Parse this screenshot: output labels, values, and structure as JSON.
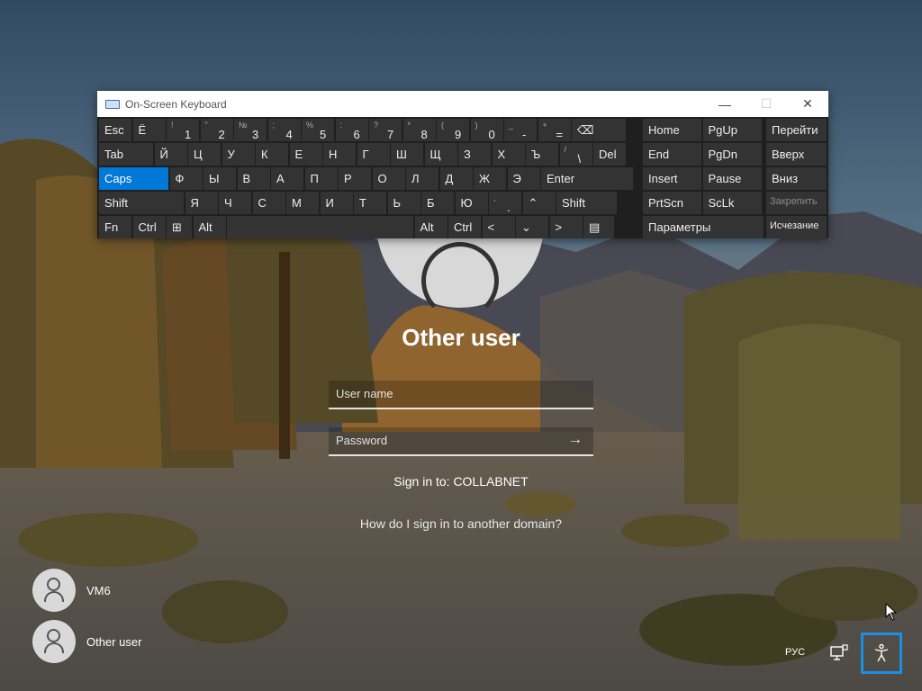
{
  "osk": {
    "title": "On-Screen Keyboard",
    "controls": {
      "minimize": "—",
      "maximize": "☐",
      "close": "✕"
    },
    "rows": [
      [
        {
          "main": "Esc"
        },
        {
          "main": "Ё"
        },
        {
          "up": "!",
          "down": "1"
        },
        {
          "up": "\"",
          "down": "2"
        },
        {
          "up": "№",
          "down": "3"
        },
        {
          "up": ";",
          "down": "4"
        },
        {
          "up": "%",
          "down": "5"
        },
        {
          "up": ":",
          "down": "6"
        },
        {
          "up": "?",
          "down": "7"
        },
        {
          "up": "*",
          "down": "8"
        },
        {
          "up": "(",
          "down": "9"
        },
        {
          "up": ")",
          "down": "0"
        },
        {
          "up": "_",
          "down": "-"
        },
        {
          "up": "+",
          "down": "="
        },
        {
          "main": "⌫"
        }
      ],
      [
        {
          "main": "Tab"
        },
        {
          "main": "Й"
        },
        {
          "main": "Ц"
        },
        {
          "main": "У"
        },
        {
          "main": "К"
        },
        {
          "main": "Е"
        },
        {
          "main": "Н"
        },
        {
          "main": "Г"
        },
        {
          "main": "Ш"
        },
        {
          "main": "Щ"
        },
        {
          "main": "З"
        },
        {
          "main": "Х"
        },
        {
          "main": "Ъ"
        },
        {
          "up": "/",
          "down": "\\"
        },
        {
          "main": "Del"
        }
      ],
      [
        {
          "main": "Caps"
        },
        {
          "main": "Ф"
        },
        {
          "main": "Ы"
        },
        {
          "main": "В"
        },
        {
          "main": "А"
        },
        {
          "main": "П"
        },
        {
          "main": "Р"
        },
        {
          "main": "О"
        },
        {
          "main": "Л"
        },
        {
          "main": "Д"
        },
        {
          "main": "Ж"
        },
        {
          "main": "Э"
        },
        {
          "main": "Enter"
        }
      ],
      [
        {
          "main": "Shift"
        },
        {
          "main": "Я"
        },
        {
          "main": "Ч"
        },
        {
          "main": "С"
        },
        {
          "main": "М"
        },
        {
          "main": "И"
        },
        {
          "main": "Т"
        },
        {
          "main": "Ь"
        },
        {
          "main": "Б"
        },
        {
          "main": "Ю"
        },
        {
          "up": ",",
          "down": "."
        },
        {
          "main": "⌃"
        },
        {
          "main": "Shift"
        }
      ],
      [
        {
          "main": "Fn"
        },
        {
          "main": "Ctrl"
        },
        {
          "main": "⊞"
        },
        {
          "main": "Alt"
        },
        {
          "main": ""
        },
        {
          "main": "Alt"
        },
        {
          "main": "Ctrl"
        },
        {
          "main": "<"
        },
        {
          "main": "⌄"
        },
        {
          "main": ">"
        },
        {
          "main": "▤"
        }
      ]
    ],
    "nav": [
      [
        "Home",
        "PgUp"
      ],
      [
        "End",
        "PgDn"
      ],
      [
        "Insert",
        "Pause"
      ],
      [
        "PrtScn",
        "ScLk"
      ],
      [
        "Параметры"
      ]
    ],
    "side": [
      "Перейти",
      "Вверх",
      "Вниз",
      "Закрепить",
      "Исчезание"
    ]
  },
  "login": {
    "title": "Other user",
    "username_placeholder": "User name",
    "password_placeholder": "Password",
    "submit_arrow": "→",
    "sign_in_to": "Sign in to: COLLABNET",
    "other_domain": "How do I sign in to another domain?"
  },
  "users": [
    {
      "name": "VM6"
    },
    {
      "name": "Other user"
    }
  ],
  "tray": {
    "language": "РУС",
    "network_icon": "network-icon",
    "accessibility_icon": "accessibility-icon"
  }
}
